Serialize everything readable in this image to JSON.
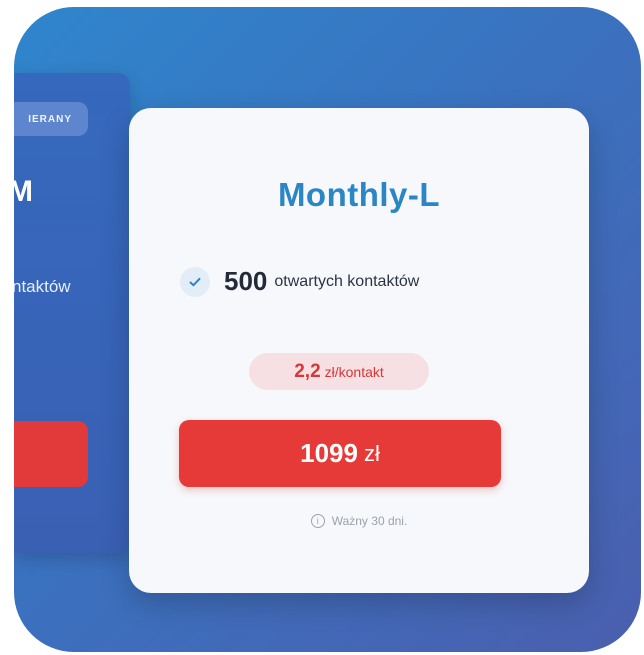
{
  "left_plan": {
    "badge": "IERANY",
    "title": "M",
    "contacts_fragment": "ntaktów"
  },
  "plan": {
    "title": "Monthly-L",
    "feature": {
      "icon": "check-icon",
      "count": "500",
      "text": "otwartych kontaktów"
    },
    "price_per_contact": {
      "value": "2,2",
      "unit": "zł/kontakt"
    },
    "buy_button": {
      "amount": "1099",
      "currency": "zł"
    },
    "validity": {
      "icon": "info-icon",
      "text": "Ważny 30 dni."
    }
  },
  "colors": {
    "accent_blue": "#2b86c5",
    "cta_red": "#e53a38",
    "background_gradient": [
      "#2f86cc",
      "#4a5fae"
    ]
  }
}
